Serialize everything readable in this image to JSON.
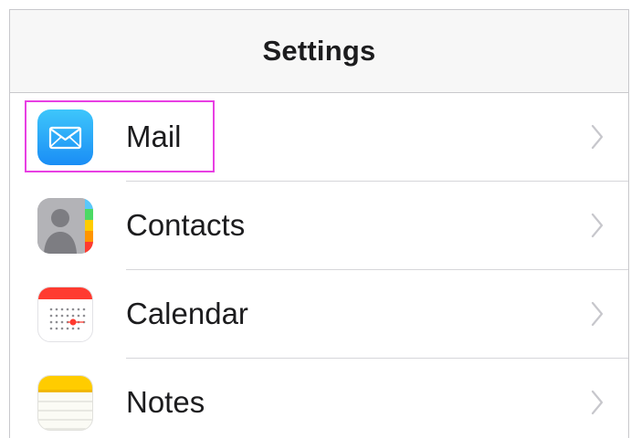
{
  "navbar": {
    "title": "Settings"
  },
  "rows": [
    {
      "label": "Mail",
      "icon": "mail-icon",
      "highlighted": true
    },
    {
      "label": "Contacts",
      "icon": "contacts-icon",
      "highlighted": false
    },
    {
      "label": "Calendar",
      "icon": "calendar-icon",
      "highlighted": false
    },
    {
      "label": "Notes",
      "icon": "notes-icon",
      "highlighted": false
    }
  ],
  "colors": {
    "highlight": "#e83fe3",
    "navbar_background": "#f7f7f7",
    "separator": "#d6d6da",
    "chevron": "#c7c7cc"
  }
}
